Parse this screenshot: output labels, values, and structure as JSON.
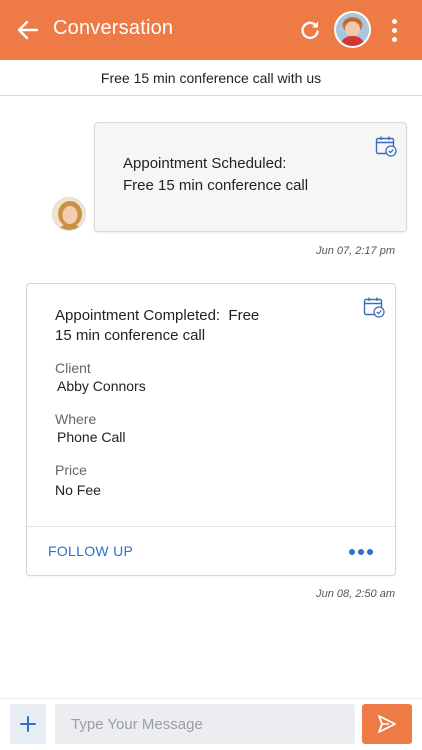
{
  "header": {
    "title": "Conversation",
    "back_icon": "arrow-left-icon",
    "refresh_icon": "refresh-icon",
    "more_icon": "vertical-dots-icon",
    "accent_color": "#ee7b45"
  },
  "subheader": {
    "text": "Free 15 min conference call with us"
  },
  "messages": [
    {
      "heading_line1": "Appointment Scheduled:",
      "heading_line2": "Free 15 min conference call",
      "icon": "calendar-check-icon",
      "timestamp": "Jun 07, 2:17 pm"
    },
    {
      "heading_line1": "Appointment Completed:  Free",
      "heading_line2": "15 min conference call",
      "icon": "calendar-check-icon",
      "fields": [
        {
          "label": "Client",
          "value": "Abby Connors"
        },
        {
          "label": "Where",
          "value": "Phone Call"
        },
        {
          "label": "Price",
          "value": "No Fee"
        }
      ],
      "action_label": "FOLLOW UP",
      "more_icon": "horizontal-dots-icon",
      "timestamp": "Jun 08, 2:50 am"
    }
  ],
  "composer": {
    "placeholder": "Type Your Message",
    "add_icon": "plus-icon",
    "send_icon": "send-icon"
  }
}
